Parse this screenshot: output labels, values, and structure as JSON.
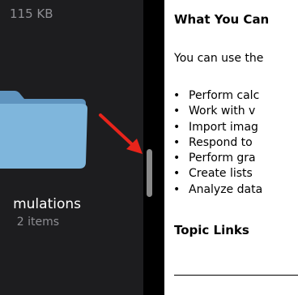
{
  "left_pane": {
    "file_size": "115 KB",
    "folder": {
      "name": "mulations",
      "item_count": "2 items",
      "icon": "folder-icon"
    }
  },
  "document": {
    "heading": "What You Can",
    "intro": "You can use the",
    "features": [
      "Perform calc",
      "Work with v",
      "Import imag",
      "Respond to",
      "Perform gra",
      "Create lists",
      "Analyze data"
    ],
    "links_heading": "Topic Links"
  },
  "colors": {
    "pane_background": "#1d1d1f",
    "folder_blue": "#7fb6dc",
    "annotation_arrow": "#e8241b",
    "scroll_thumb": "#8a8a8a"
  }
}
